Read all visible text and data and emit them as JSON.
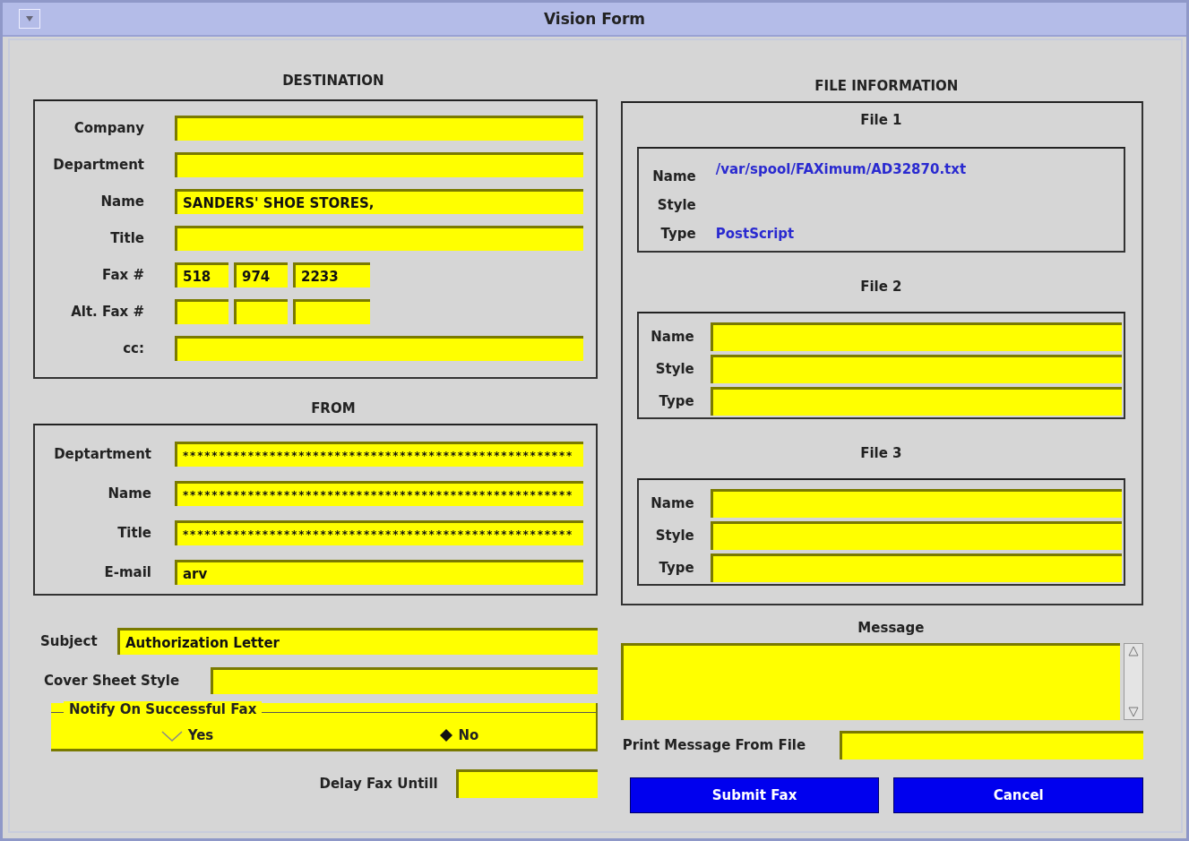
{
  "window": {
    "title": "Vision Form"
  },
  "destination": {
    "heading": "DESTINATION",
    "fields": [
      {
        "kind": "text",
        "label": "Company"
      },
      {
        "kind": "text",
        "label": "Department"
      },
      {
        "kind": "text",
        "label": "Name",
        "value": "SANDERS' SHOE STORES,"
      },
      {
        "kind": "text",
        "label": "Title"
      },
      {
        "kind": "fax",
        "label": "Fax #",
        "parts": [
          {
            "value": "518"
          },
          {
            "value": "974"
          },
          {
            "value": "2233"
          }
        ]
      },
      {
        "kind": "fax",
        "label": "Alt. Fax #"
      },
      {
        "kind": "text",
        "label": "cc:"
      }
    ]
  },
  "from": {
    "heading": "FROM",
    "fields": [
      {
        "label": "Deptartment",
        "value": "******************************************************"
      },
      {
        "label": "Name",
        "value": "******************************************************"
      },
      {
        "label": "Title",
        "value": "******************************************************"
      },
      {
        "label": "E-mail",
        "value": "arv"
      }
    ]
  },
  "subject": {
    "label": "Subject",
    "value": "Authorization Letter"
  },
  "cover_sheet_style": {
    "label": "Cover Sheet Style"
  },
  "notify": {
    "legend": "Notify On Successful Fax",
    "options": [
      {
        "label": "Yes",
        "selected": false
      },
      {
        "label": "No",
        "selected": true
      }
    ]
  },
  "delay": {
    "label": "Delay Fax Untill"
  },
  "file_information": {
    "heading": "FILE INFORMATION",
    "files": [
      {
        "heading": "File 1",
        "kind": "static",
        "rows": [
          {
            "label": "Name",
            "value": "/var/spool/FAXimum/AD32870.txt"
          },
          {
            "label": "Style"
          },
          {
            "label": "Type",
            "value": "PostScript"
          }
        ]
      },
      {
        "heading": "File 2",
        "kind": "fields",
        "rows": [
          {
            "label": "Name"
          },
          {
            "label": "Style"
          },
          {
            "label": "Type"
          }
        ]
      },
      {
        "heading": "File 3",
        "kind": "fields",
        "rows": [
          {
            "label": "Name"
          },
          {
            "label": "Style"
          },
          {
            "label": "Type"
          }
        ]
      }
    ]
  },
  "message": {
    "heading": "Message"
  },
  "print_message_from_file": {
    "label": "Print Message From File"
  },
  "buttons": [
    "Submit Fax",
    "Cancel"
  ]
}
